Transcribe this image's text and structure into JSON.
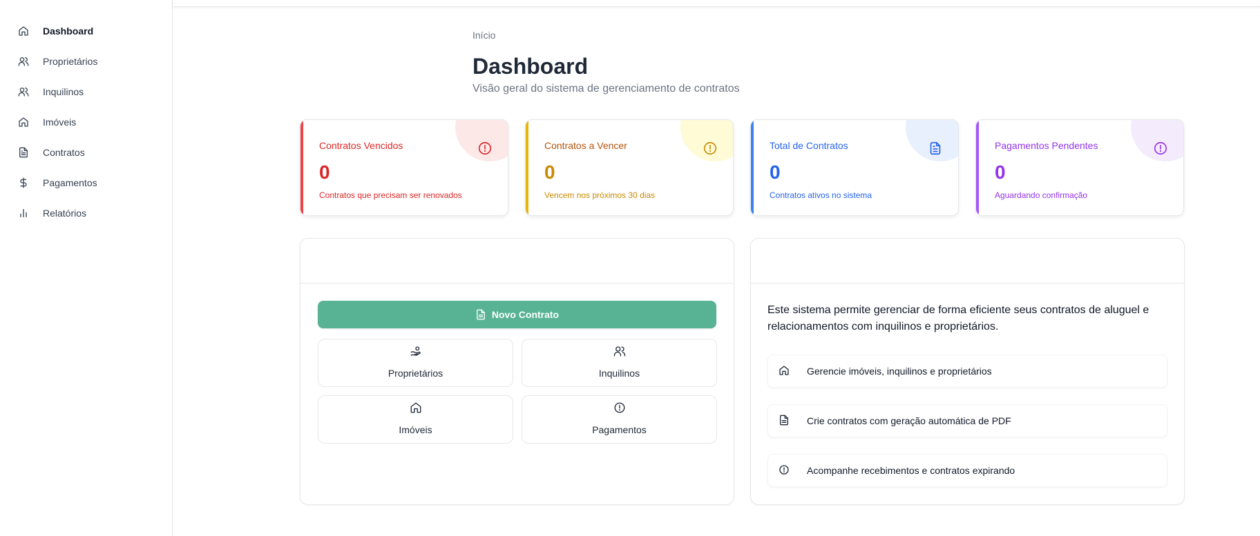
{
  "sidebar": {
    "items": [
      {
        "label": "Dashboard",
        "icon": "home-icon"
      },
      {
        "label": "Proprietários",
        "icon": "users-icon"
      },
      {
        "label": "Inquilinos",
        "icon": "users-icon"
      },
      {
        "label": "Imóveis",
        "icon": "home-icon"
      },
      {
        "label": "Contratos",
        "icon": "file-text-icon"
      },
      {
        "label": "Pagamentos",
        "icon": "dollar-icon"
      },
      {
        "label": "Relatórios",
        "icon": "bar-chart-icon"
      }
    ]
  },
  "page": {
    "breadcrumb": "Início",
    "title": "Dashboard",
    "subtitle": "Visão geral do sistema de gerenciamento de contratos"
  },
  "stats": [
    {
      "title": "Contratos Vencidos",
      "value": "0",
      "description": "Contratos que precisam ser renovados",
      "color": "#dc2626",
      "bar": "#ef4444",
      "circle": "#fde8e8",
      "icon": "alert-circle-icon"
    },
    {
      "title": "Contratos a Vencer",
      "value": "0",
      "description": "Vencem nos próximos 30 dias",
      "color": "#ca8a04",
      "bar": "#eab308",
      "circle": "#fefbd6",
      "icon": "alert-circle-icon"
    },
    {
      "title": "Total de Contratos",
      "value": "0",
      "description": "Contratos ativos no sistema",
      "color": "#2563eb",
      "bar": "#3b82f6",
      "circle": "#e8f0fd",
      "icon": "file-text-icon"
    },
    {
      "title": "Pagamentos Pendentes",
      "value": "0",
      "description": "Aguardando confirmação",
      "color": "#9333ea",
      "bar": "#a855f7",
      "circle": "#f4ebfd",
      "icon": "alert-circle-icon"
    }
  ],
  "actions": {
    "primary_label": "Novo Contrato",
    "primary_color": "#57b394",
    "quick": [
      {
        "label": "Proprietários",
        "icon": "hand-coins-icon"
      },
      {
        "label": "Inquilinos",
        "icon": "users-icon"
      },
      {
        "label": "Imóveis",
        "icon": "home-icon"
      },
      {
        "label": "Pagamentos",
        "icon": "alert-circle-icon"
      }
    ]
  },
  "info": {
    "text": "Este sistema permite gerenciar de forma eficiente seus contratos de aluguel e relacionamentos com inquilinos e proprietários.",
    "features": [
      {
        "label": "Gerencie imóveis, inquilinos e proprietários",
        "icon": "home-icon"
      },
      {
        "label": "Crie contratos com geração automática de PDF",
        "icon": "file-text-icon"
      },
      {
        "label": "Acompanhe recebimentos e contratos expirando",
        "icon": "alert-circle-icon"
      }
    ]
  }
}
